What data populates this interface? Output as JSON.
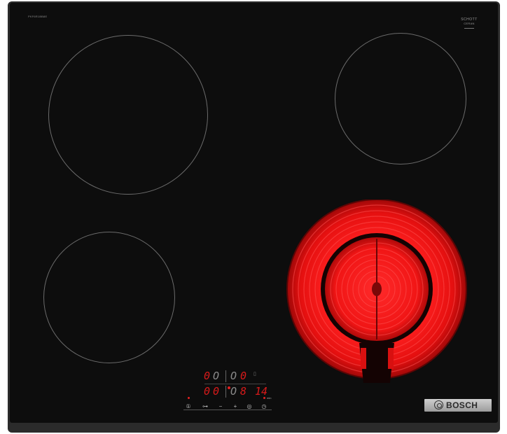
{
  "appliance": {
    "model_code": "PKF6R1BB8E",
    "glass_maker": "SCHOTT",
    "glass_product": "CERAN",
    "brand": "BOSCH"
  },
  "display": {
    "zone_left_front": "0",
    "zone_left_rear": "0",
    "zone_right_front": "0",
    "zone_right_rear": "0",
    "active_level": "8",
    "timer": "14",
    "timer_unit": "min"
  },
  "controls": {
    "power": "①",
    "lock": "⊶",
    "minus": "−",
    "plus": "+",
    "boost": "◎",
    "timer": "◷"
  },
  "colors": {
    "glass": "#0d0d0d",
    "frame": "#2b2b2b",
    "ring_outline": "#6b6b6b",
    "heating_red": "#ff1a1a",
    "display_red": "#d91a1a"
  }
}
